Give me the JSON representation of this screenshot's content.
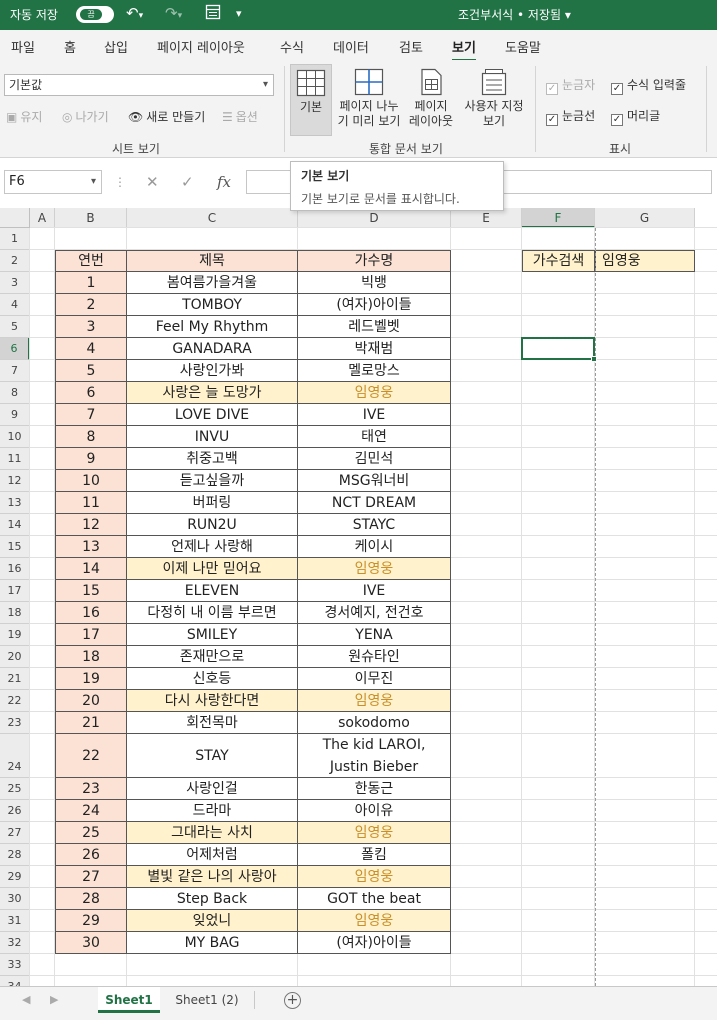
{
  "titlebar": {
    "autosave_label": "자동 저장",
    "autosave_state": "끔",
    "doc_title": "조건부서식 • 저장됨 ▾",
    "undo_icon": "undo-icon",
    "redo_icon": "redo-icon",
    "form_icon": "form-icon",
    "customize_icon": "customize-qat-icon"
  },
  "tabs": [
    "파일",
    "홈",
    "삽입",
    "페이지 레이아웃",
    "수식",
    "데이터",
    "검토",
    "보기",
    "도움말"
  ],
  "active_tab": "보기",
  "ribbon": {
    "sheet_view": {
      "select_value": "기본값",
      "keep_label": "유지",
      "exit_label": "나가기",
      "new_label": "새로 만들기",
      "options_label": "옵션",
      "group_label": "시트 보기"
    },
    "workbook_views": {
      "normal_label": "기본",
      "page_break_line1": "페이지 나누",
      "page_break_line2": "기 미리 보기",
      "page_layout_line1": "페이지",
      "page_layout_line2": "레이아웃",
      "custom_line1": "사용자 지정",
      "custom_line2": "보기",
      "group_label": "통합 문서 보기"
    },
    "show": {
      "ruler_label": "눈금자",
      "formula_bar_label": "수식 입력줄",
      "gridlines_label": "눈금선",
      "headings_label": "머리글",
      "group_label": "표시"
    }
  },
  "formula_bar": {
    "name_box": "F6",
    "value": ""
  },
  "tooltip": {
    "title": "기본 보기",
    "body": "기본 보기로 문서를 표시합니다."
  },
  "colors": {
    "accent": "#217346",
    "header_fill": "#fbe2d5",
    "highlight_fill": "#fff2cc",
    "highlight_text": "#c9902a",
    "search_fill": "#fff2cc"
  },
  "columns": [
    "A",
    "B",
    "C",
    "D",
    "E",
    "F",
    "G"
  ],
  "rows": [
    "1",
    "2",
    "3",
    "4",
    "5",
    "6",
    "7",
    "8",
    "9",
    "10",
    "11",
    "12",
    "13",
    "14",
    "15",
    "16",
    "17",
    "18",
    "19",
    "20",
    "21",
    "22",
    "23",
    "24",
    "25",
    "26",
    "27",
    "28",
    "29",
    "30",
    "31",
    "32",
    "33",
    "34"
  ],
  "table": {
    "headers": [
      "연번",
      "제목",
      "가수명"
    ],
    "rows": [
      {
        "no": "1",
        "title": "봄여름가을겨울",
        "artist": "빅뱅",
        "hl": false
      },
      {
        "no": "2",
        "title": "TOMBOY",
        "artist": "(여자)아이들",
        "hl": false
      },
      {
        "no": "3",
        "title": "Feel My Rhythm",
        "artist": "레드벨벳",
        "hl": false
      },
      {
        "no": "4",
        "title": "GANADARA",
        "artist": "박재범",
        "hl": false
      },
      {
        "no": "5",
        "title": "사랑인가봐",
        "artist": "멜로망스",
        "hl": false
      },
      {
        "no": "6",
        "title": "사랑은 늘 도망가",
        "artist": "임영웅",
        "hl": true
      },
      {
        "no": "7",
        "title": "LOVE DIVE",
        "artist": "IVE",
        "hl": false
      },
      {
        "no": "8",
        "title": "INVU",
        "artist": "태연",
        "hl": false
      },
      {
        "no": "9",
        "title": "취중고백",
        "artist": "김민석",
        "hl": false
      },
      {
        "no": "10",
        "title": "듣고싶을까",
        "artist": "MSG워너비",
        "hl": false
      },
      {
        "no": "11",
        "title": "버퍼링",
        "artist": "NCT DREAM",
        "hl": false
      },
      {
        "no": "12",
        "title": "RUN2U",
        "artist": "STAYC",
        "hl": false
      },
      {
        "no": "13",
        "title": "언제나 사랑해",
        "artist": "케이시",
        "hl": false
      },
      {
        "no": "14",
        "title": "이제 나만 믿어요",
        "artist": "임영웅",
        "hl": true
      },
      {
        "no": "15",
        "title": "ELEVEN",
        "artist": "IVE",
        "hl": false
      },
      {
        "no": "16",
        "title": "다정히 내 이름 부르면",
        "artist": "경서예지, 전건호",
        "hl": false
      },
      {
        "no": "17",
        "title": "SMILEY",
        "artist": "YENA",
        "hl": false
      },
      {
        "no": "18",
        "title": "존재만으로",
        "artist": "원슈타인",
        "hl": false
      },
      {
        "no": "19",
        "title": "신호등",
        "artist": "이무진",
        "hl": false
      },
      {
        "no": "20",
        "title": "다시 사랑한다면",
        "artist": "임영웅",
        "hl": true
      },
      {
        "no": "21",
        "title": "회전목마",
        "artist": "sokodomo",
        "hl": false
      },
      {
        "no": "22",
        "title": "STAY",
        "artist": "The kid LAROI,",
        "artist2": "Justin Bieber",
        "hl": false
      },
      {
        "no": "23",
        "title": "사랑인걸",
        "artist": "한동근",
        "hl": false
      },
      {
        "no": "24",
        "title": "드라마",
        "artist": "아이유",
        "hl": false
      },
      {
        "no": "25",
        "title": "그대라는 사치",
        "artist": "임영웅",
        "hl": true
      },
      {
        "no": "26",
        "title": "어제처럼",
        "artist": "폴킴",
        "hl": false
      },
      {
        "no": "27",
        "title": "별빛 같은 나의 사랑아",
        "artist": "임영웅",
        "hl": true
      },
      {
        "no": "28",
        "title": "Step Back",
        "artist": "GOT the beat",
        "hl": false
      },
      {
        "no": "29",
        "title": "잊었니",
        "artist": "임영웅",
        "hl": true
      },
      {
        "no": "30",
        "title": "MY BAG",
        "artist": "(여자)아이들",
        "hl": false
      }
    ]
  },
  "search": {
    "label": "가수검색",
    "value": "임영웅"
  },
  "sheets": [
    "Sheet1",
    "Sheet1 (2)"
  ],
  "active_sheet": "Sheet1"
}
